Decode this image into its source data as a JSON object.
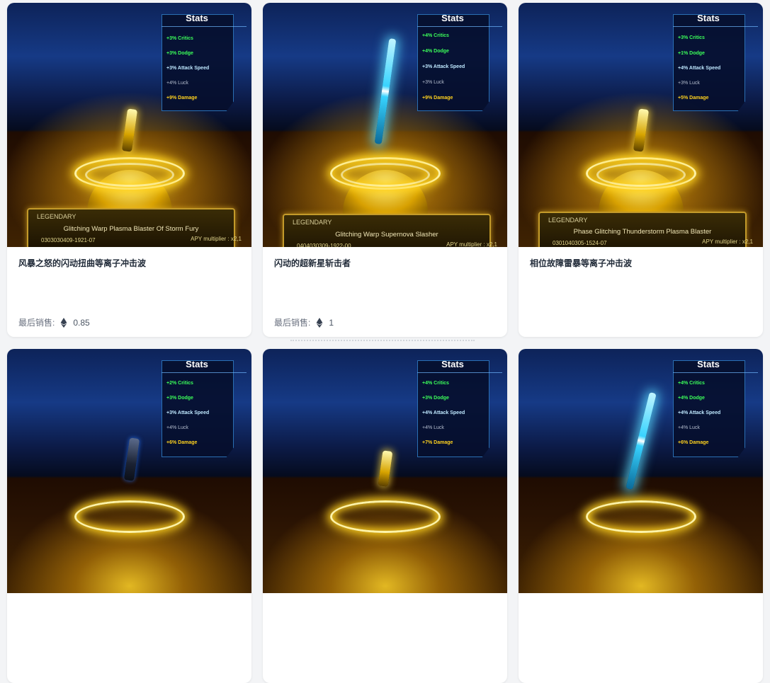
{
  "stats_heading": "Stats",
  "plate_tier": "LEGENDARY",
  "last_sale_label": "最后销售:",
  "cards": [
    {
      "title": "风暴之怒的闪动扭曲等离子冲击波",
      "stats": [
        "+3% Critics",
        "+3% Dodge",
        "+3% Attack Speed",
        "+4% Luck",
        "+9% Damage"
      ],
      "plate_name": "Glitching Warp Plasma Blaster Of Storm Fury",
      "plate_id": "0303030409-1921-07",
      "plate_apy": "APY multiplier : x2,1",
      "last_sale": "0.85",
      "weapon": "gold-blaster-icon"
    },
    {
      "title": "闪动的超新星斩击者",
      "stats": [
        "+4% Critics",
        "+4% Dodge",
        "+3% Attack Speed",
        "+3% Luck",
        "+9% Damage"
      ],
      "plate_name": "Glitching Warp Supernova Slasher",
      "plate_id": "0404030309-1922-00",
      "plate_apy": "APY multiplier : x2,1",
      "last_sale": "1",
      "weapon": "blue-blade-icon"
    },
    {
      "title": "相位故障雷暴等离子冲击波",
      "stats": [
        "+3% Critics",
        "+1% Dodge",
        "+4% Attack Speed",
        "+3% Luck",
        "+5% Damage"
      ],
      "plate_name": "Phase Glitching Thunderstorm Plasma Blaster",
      "plate_id": "0301040305-1524-07",
      "plate_apy": "APY multiplier : x2,1",
      "last_sale": "",
      "weapon": "gold-blaster-icon"
    },
    {
      "title": "",
      "stats": [
        "+2% Critics",
        "+3% Dodge",
        "+3% Attack Speed",
        "+4% Luck",
        "+6% Damage"
      ],
      "weapon": "dark-blaster-icon"
    },
    {
      "title": "",
      "stats": [
        "+4% Critics",
        "+3% Dodge",
        "+4% Attack Speed",
        "+4% Luck",
        "+7% Damage"
      ],
      "weapon": "gold-blaster-icon"
    },
    {
      "title": "",
      "stats": [
        "+4% Critics",
        "+4% Dodge",
        "+4% Attack Speed",
        "+4% Luck",
        "+6% Damage"
      ],
      "weapon": "blue-blade-icon"
    }
  ]
}
